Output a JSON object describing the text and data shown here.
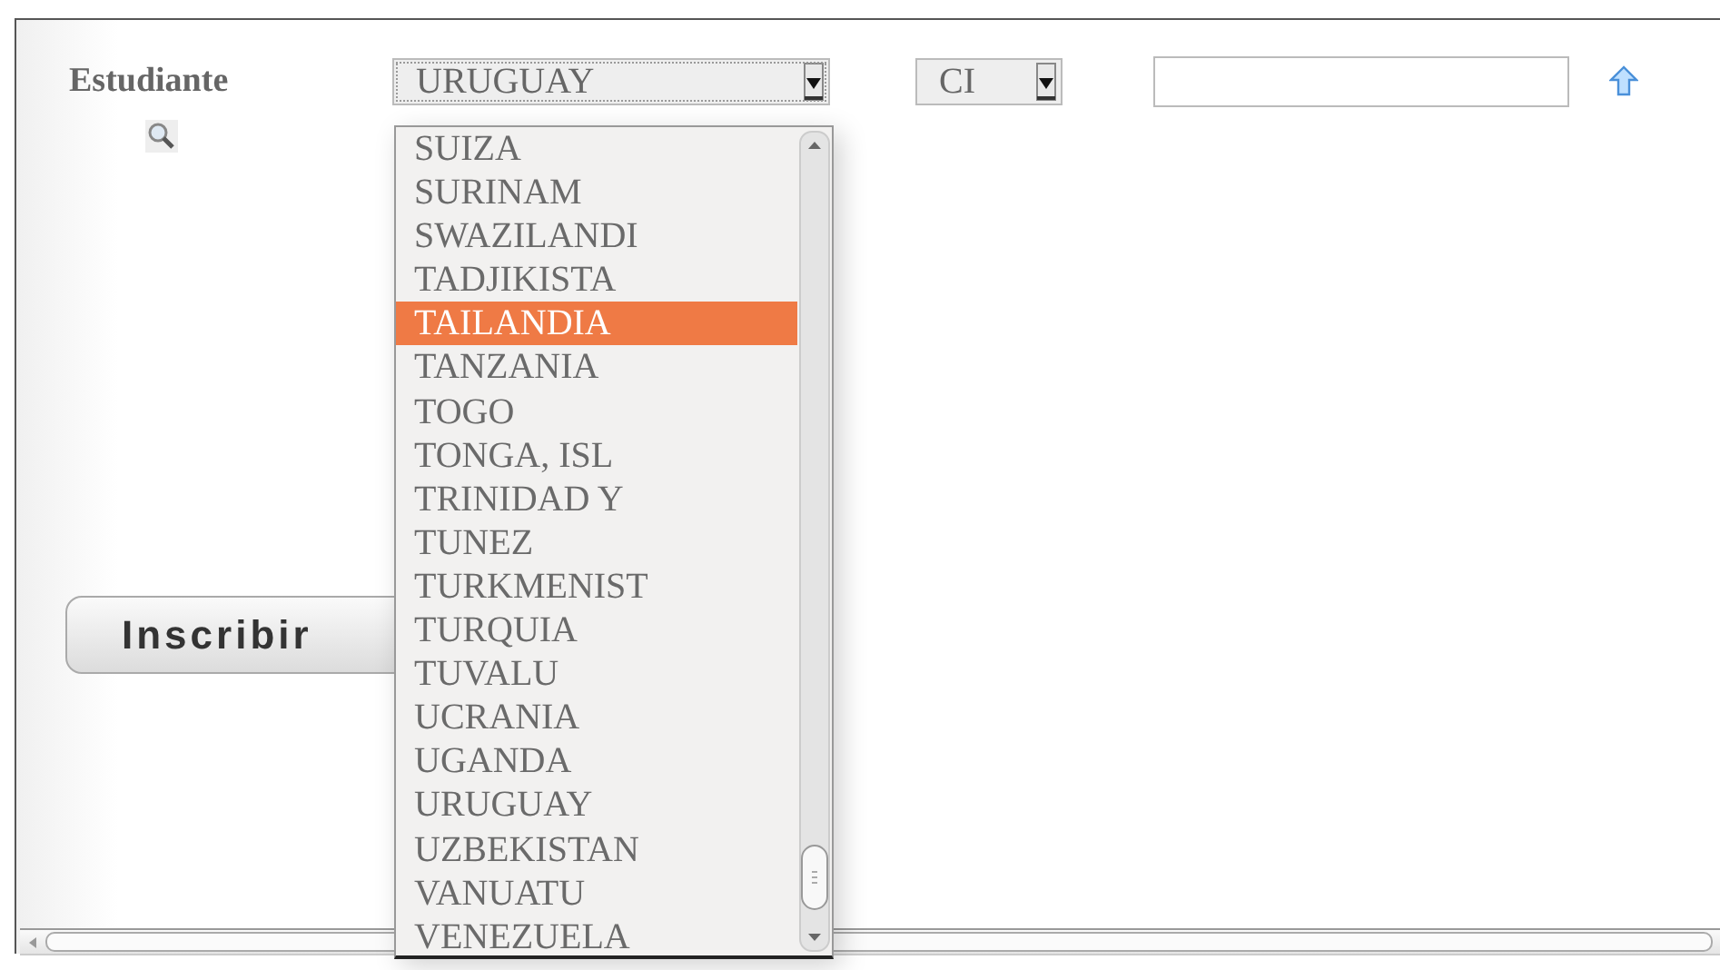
{
  "student_label": "Estudiante",
  "country_select": {
    "value": "URUGUAY",
    "expanded": true
  },
  "document_type_select": {
    "value": "CI"
  },
  "country_options": [
    {
      "label": "SUIZA",
      "selected": false
    },
    {
      "label": "SURINAM",
      "selected": false
    },
    {
      "label": "SWAZILANDI",
      "selected": false
    },
    {
      "label": "TADJIKISTA",
      "selected": false
    },
    {
      "label": "TAILANDIA",
      "selected": true
    },
    {
      "label": "TANZANIA",
      "selected": false
    },
    {
      "label": "TOGO",
      "selected": false
    },
    {
      "label": "TONGA, ISL",
      "selected": false
    },
    {
      "label": "TRINIDAD Y",
      "selected": false
    },
    {
      "label": "TUNEZ",
      "selected": false
    },
    {
      "label": "TURKMENIST",
      "selected": false
    },
    {
      "label": "TURQUIA",
      "selected": false
    },
    {
      "label": "TUVALU",
      "selected": false
    },
    {
      "label": "UCRANIA",
      "selected": false
    },
    {
      "label": "UGANDA",
      "selected": false
    },
    {
      "label": "URUGUAY",
      "selected": false
    },
    {
      "label": "UZBEKISTAN",
      "selected": false
    },
    {
      "label": "VANUATU",
      "selected": false
    },
    {
      "label": "VENEZUELA",
      "selected": false
    }
  ],
  "submit_button": "Inscribir"
}
